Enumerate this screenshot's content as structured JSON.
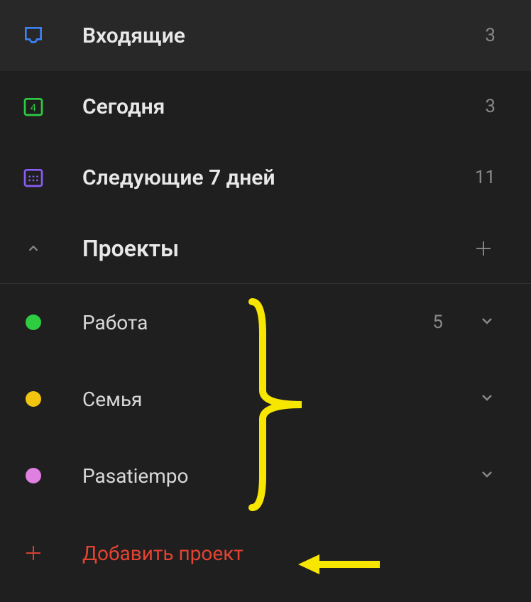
{
  "nav": {
    "inbox": {
      "label": "Входящие",
      "count": "3"
    },
    "today": {
      "label": "Сегодня",
      "count": "3",
      "day": "4"
    },
    "upcoming": {
      "label": "Следующие 7 дней",
      "count": "11"
    }
  },
  "projectsSection": {
    "label": "Проекты"
  },
  "projects": [
    {
      "label": "Работа",
      "count": "5",
      "color": "#2ecc40"
    },
    {
      "label": "Семья",
      "count": "",
      "color": "#f1c40f"
    },
    {
      "label": "Pasatiempo",
      "count": "",
      "color": "#e080e0"
    }
  ],
  "addProject": {
    "label": "Добавить проект"
  }
}
